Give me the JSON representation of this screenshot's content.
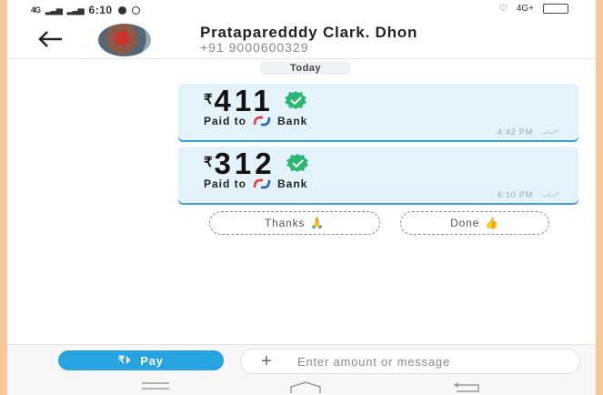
{
  "status_bar": {
    "network": "4G",
    "time": "6:10",
    "right_text": "4G+"
  },
  "header": {
    "back_icon": "arrow-left-icon",
    "contact_name": "Prataparedddy Clark. Dhon",
    "contact_phone": "+91 9000600329"
  },
  "chat": {
    "date_label": "Today",
    "messages": [
      {
        "currency": "₹",
        "amount": "411",
        "paid_to": "Paid to",
        "bank": "Bank",
        "time": "4:42 PM"
      },
      {
        "currency": "₹",
        "amount": "312",
        "paid_to": "Paid to",
        "bank": "Bank",
        "time": "6:10 PM"
      }
    ],
    "quick_replies": [
      {
        "label": "Thanks",
        "emoji": "🙏"
      },
      {
        "label": "Done",
        "emoji": "👍"
      }
    ]
  },
  "bottom": {
    "pay_icon": "₹⏵",
    "pay_label": "Pay",
    "input_placeholder": "Enter amount or message"
  },
  "colors": {
    "accent": "#27a4e0",
    "bubble": "#e3f2fb",
    "check": "#2bb673",
    "bank_red": "#e03b3b",
    "bank_blue": "#1e5fb0"
  }
}
